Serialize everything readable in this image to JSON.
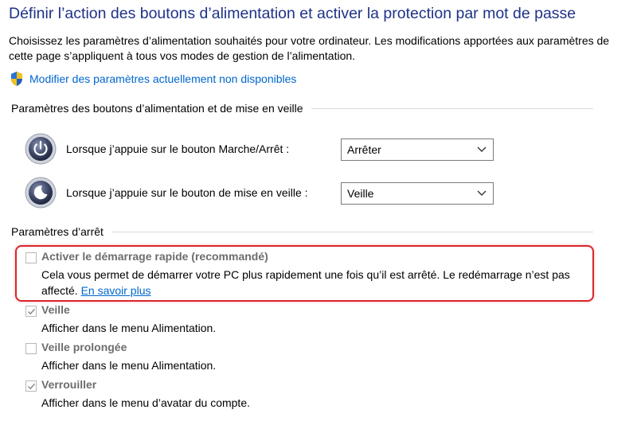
{
  "header": {
    "title": "Définir l’action des boutons d’alimentation et activer la protection par mot de passe",
    "description": "Choisissez les paramètres d’alimentation souhaités pour votre ordinateur. Les modifications apportées aux paramètres de cette page s’appliquent à tous vos modes de gestion de l’alimentation.",
    "admin_link": "Modifier des paramètres actuellement non disponibles",
    "admin_icon": "uac-shield-icon"
  },
  "power_buttons": {
    "section_label": "Paramètres des boutons d’alimentation et de mise en veille",
    "rows": [
      {
        "label": "Lorsque j’appuie sur le bouton Marche/Arrêt :",
        "icon": "power-button-icon",
        "value": "Arrêter"
      },
      {
        "label": "Lorsque j’appuie sur le bouton de mise en veille :",
        "icon": "sleep-button-icon",
        "value": "Veille"
      }
    ]
  },
  "shutdown": {
    "section_label": "Paramètres d’arrêt",
    "options": [
      {
        "title": "Activer le démarrage rapide (recommandé)",
        "description": "Cela vous permet de démarrer votre PC plus rapidement une fois qu’il est arrêté. Le redémarrage n’est pas affecté.",
        "link": "En savoir plus",
        "checked": false,
        "highlighted": true
      },
      {
        "title": "Veille",
        "description": "Afficher dans le menu Alimentation.",
        "checked": true
      },
      {
        "title": "Veille prolongée",
        "description": "Afficher dans le menu Alimentation.",
        "checked": false
      },
      {
        "title": "Verrouiller",
        "description": "Afficher dans le menu d’avatar du compte.",
        "checked": true
      }
    ]
  },
  "colors": {
    "title": "#1e3287",
    "link": "#0066cc",
    "highlight_border": "#d9262b",
    "disabled_text": "#6d6d6d"
  }
}
